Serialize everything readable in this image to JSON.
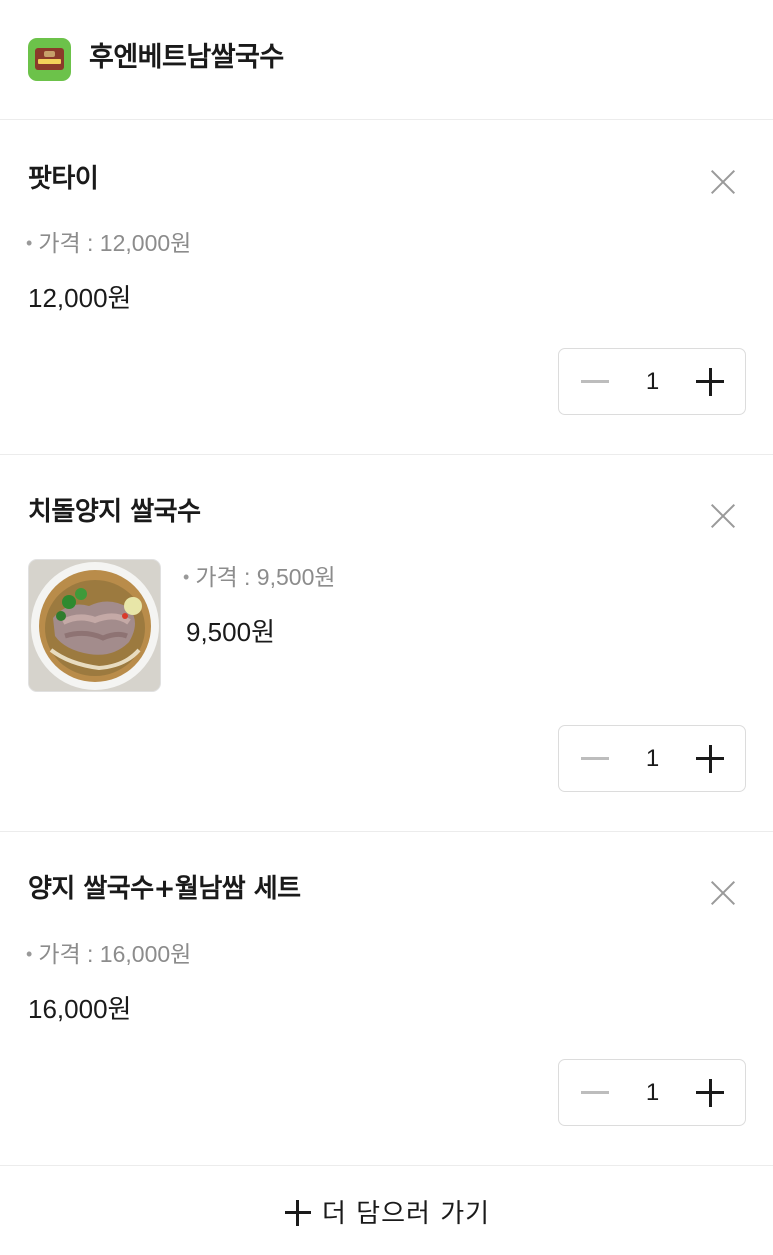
{
  "header": {
    "store_name": "후엔베트남쌀국수",
    "logo_icon": "store-logo"
  },
  "cart": {
    "price_prefix": "•",
    "items": [
      {
        "name": "팟타이",
        "price_label": "가격 : 12,000원",
        "total": "12,000원",
        "quantity": "1",
        "has_image": false
      },
      {
        "name": "치돌양지 쌀국수",
        "price_label": "가격 : 9,500원",
        "total": "9,500원",
        "quantity": "1",
        "has_image": true,
        "image_icon": "rice-noodle-soup-photo"
      },
      {
        "name": "양지 쌀국수+월남쌈 세트",
        "price_label": "가격 : 16,000원",
        "total": "16,000원",
        "quantity": "1",
        "has_image": false
      }
    ]
  },
  "footer": {
    "add_more_label": "더 담으러 가기",
    "add_more_icon": "plus-icon"
  },
  "colors": {
    "logo_green": "#6cc24a",
    "text": "#1a1a1a",
    "muted": "#8c8c8c",
    "divider": "#ececec"
  }
}
